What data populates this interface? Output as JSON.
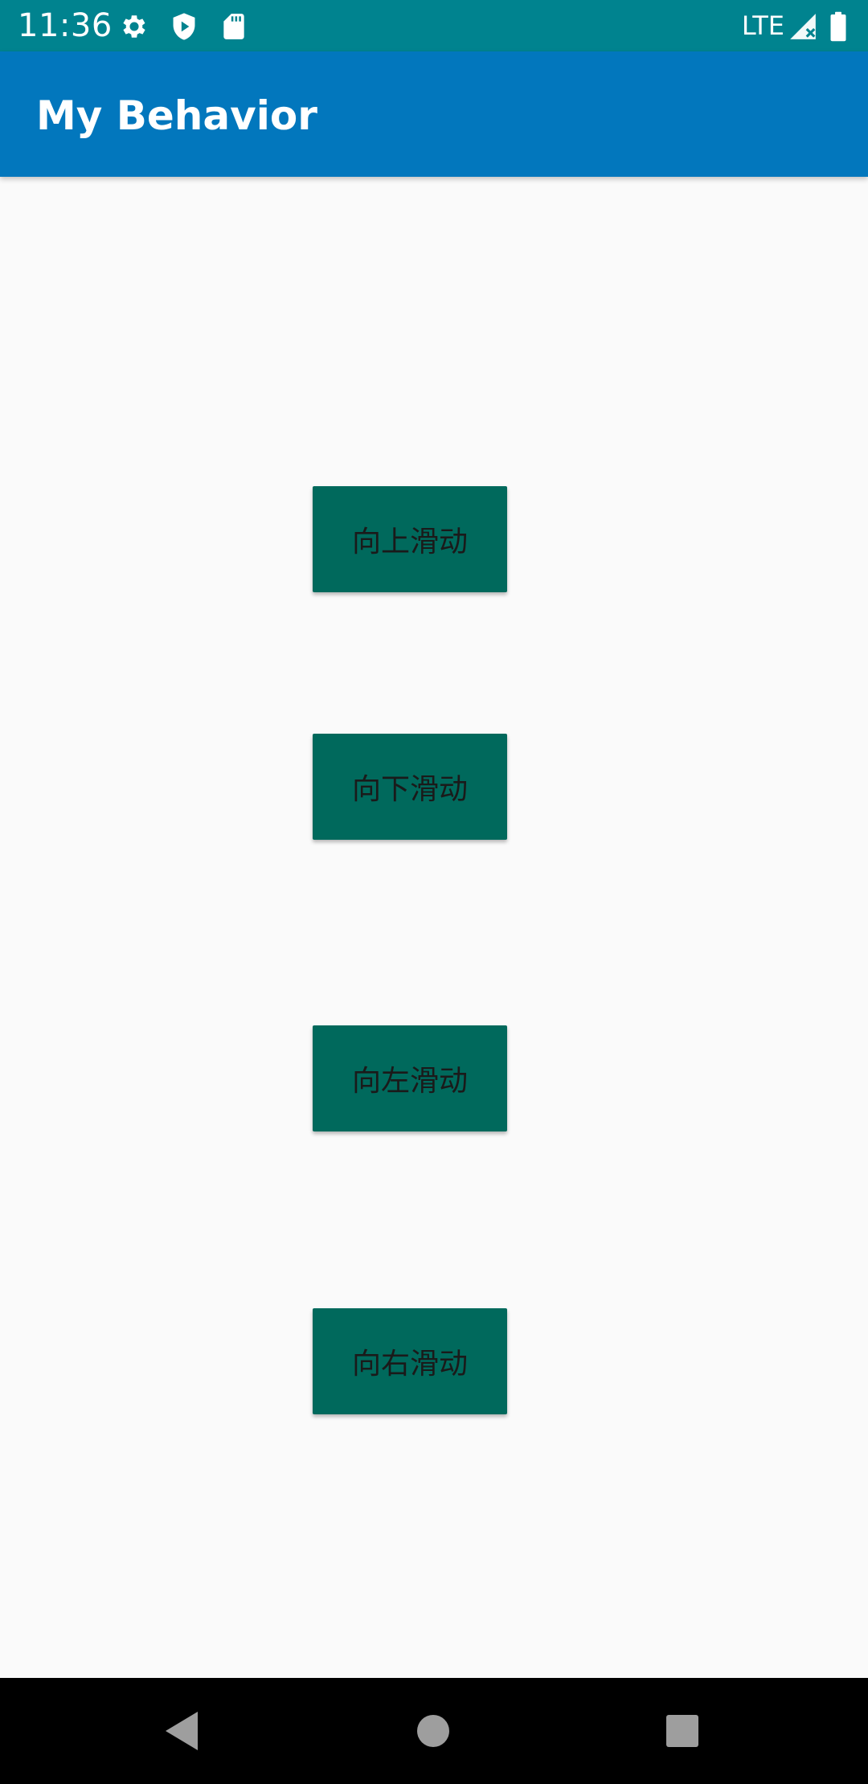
{
  "status_bar": {
    "time": "11:36",
    "network": "LTE",
    "icons": [
      "settings-icon",
      "shield-play-icon",
      "sd-card-icon",
      "signal-icon",
      "battery-icon"
    ]
  },
  "app_bar": {
    "title": "My Behavior"
  },
  "buttons": {
    "swipe_up": "向上滑动",
    "swipe_down": "向下滑动",
    "swipe_left": "向左滑动",
    "swipe_right": "向右滑动"
  },
  "nav_bar": {
    "icons": [
      "back-icon",
      "home-icon",
      "recents-icon"
    ]
  },
  "colors": {
    "status_bar": "#00838f",
    "app_bar": "#0277bd",
    "button": "#00695c",
    "background": "#fafafa"
  }
}
